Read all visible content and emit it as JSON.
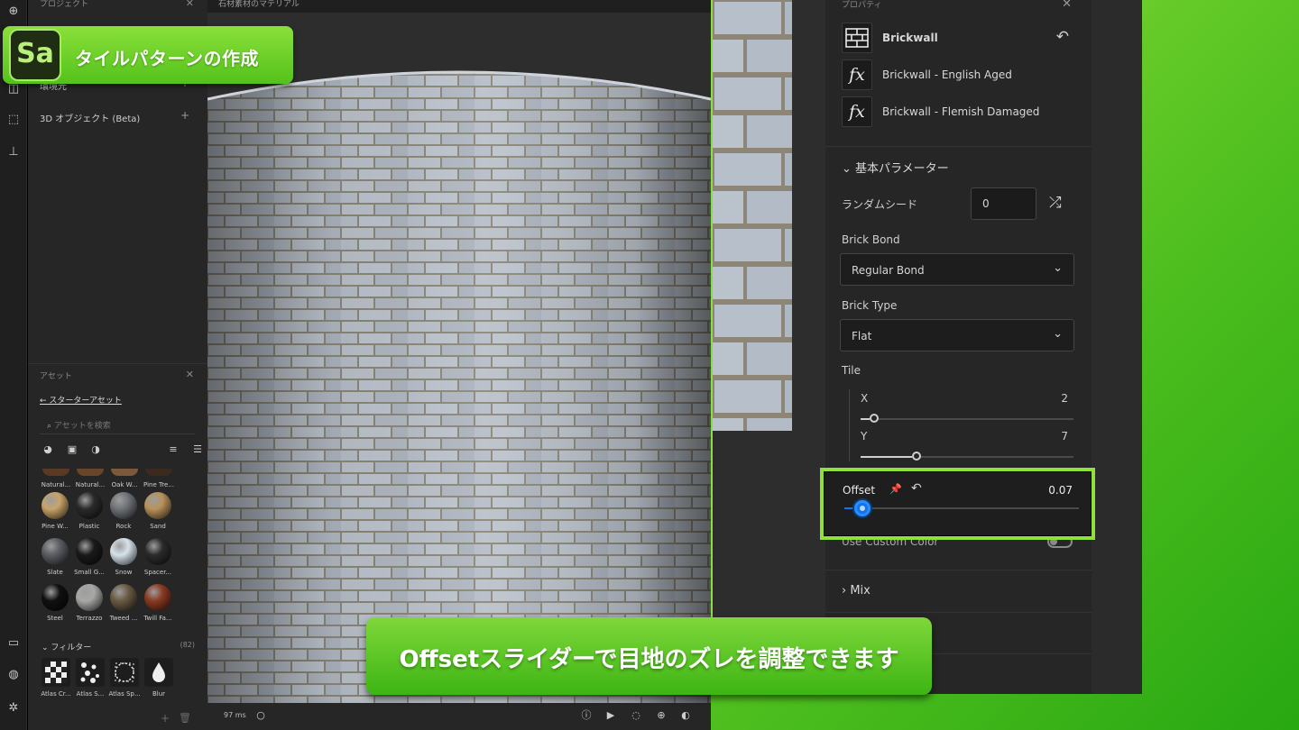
{
  "overlay": {
    "logo": "Sa",
    "title": "タイルパターンの作成",
    "caption": "Offsetスライダーで目地のズレを調整できます"
  },
  "left_panel": {
    "project_title": "プロジェクト",
    "environment_label": "環境光",
    "objects_label": "3D オブジェクト (Beta)",
    "assets_title": "アセット",
    "starter_assets_link": "スターターアセット",
    "search_placeholder": "アセットを検索",
    "partial_assets": [
      "Natural...",
      "Natural...",
      "Oak W...",
      "Pine Tre..."
    ],
    "assets": [
      {
        "label": "Pine W...",
        "color": "#c9a46a"
      },
      {
        "label": "Plastic",
        "color": "#2a2a2a"
      },
      {
        "label": "Rock",
        "color": "#6f7378"
      },
      {
        "label": "Sand",
        "color": "#b8925a"
      },
      {
        "label": "Slate",
        "color": "#5a5d62"
      },
      {
        "label": "Small G...",
        "color": "#1a1a1a"
      },
      {
        "label": "Snow",
        "color": "#d7e2ea"
      },
      {
        "label": "Spacer...",
        "color": "#2b2b2b"
      },
      {
        "label": "Steel",
        "color": "#101010"
      },
      {
        "label": "Terrazzo",
        "color": "#a8a8a6"
      },
      {
        "label": "Tweed ...",
        "color": "#6a5a44"
      },
      {
        "label": "Twill Fa...",
        "color": "#8a3a22"
      }
    ],
    "filters_label": "フィルター",
    "filters_count": "(82)",
    "filters": [
      "Atlas Cr...",
      "Atlas S...",
      "Atlas Sp...",
      "Blur"
    ]
  },
  "viewport": {
    "tab_title": "石材素材のマテリアル",
    "render_time": "97 ms"
  },
  "properties": {
    "title": "プロパティ",
    "layers": [
      {
        "label": "Brickwall",
        "icon": "brick-icon"
      },
      {
        "label": "Brickwall - English Aged",
        "icon": "fx-icon"
      },
      {
        "label": "Brickwall - Flemish Damaged",
        "icon": "fx-icon"
      }
    ],
    "fx_glyph": "fx",
    "basic_params_header": "基本パラメーター",
    "random_seed_label": "ランダムシード",
    "random_seed_value": "0",
    "brick_bond_label": "Brick Bond",
    "brick_bond_value": "Regular Bond",
    "brick_type_label": "Brick Type",
    "brick_type_value": "Flat",
    "tile_label": "Tile",
    "tile_x_label": "X",
    "tile_x_value": "2",
    "tile_y_label": "Y",
    "tile_y_value": "7",
    "offset_label": "Offset",
    "offset_value": "0.07",
    "use_custom_color_label": "Use Custom Color",
    "mix_header": "Mix"
  },
  "colors": {
    "accent_green": "#8fe03a",
    "slider_blue": "#1473e6"
  }
}
